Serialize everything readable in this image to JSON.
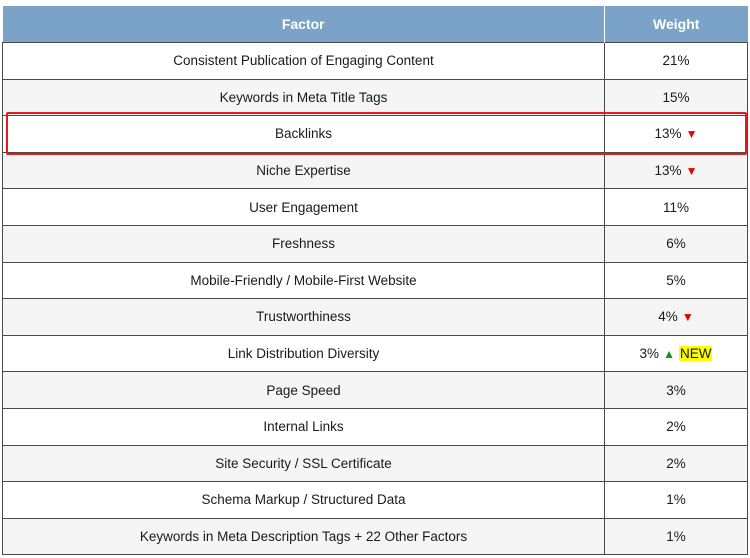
{
  "table": {
    "headers": {
      "factor": "Factor",
      "weight": "Weight"
    },
    "rows": [
      {
        "factor": "Consistent Publication of Engaging Content",
        "weight": "21%",
        "trend": "",
        "badge": ""
      },
      {
        "factor": "Keywords in Meta Title Tags",
        "weight": "15%",
        "trend": "",
        "badge": ""
      },
      {
        "factor": "Backlinks",
        "weight": "13%",
        "trend": "down",
        "badge": "",
        "highlighted": true
      },
      {
        "factor": "Niche Expertise",
        "weight": "13%",
        "trend": "down",
        "badge": ""
      },
      {
        "factor": "User Engagement",
        "weight": "11%",
        "trend": "",
        "badge": ""
      },
      {
        "factor": "Freshness",
        "weight": "6%",
        "trend": "",
        "badge": ""
      },
      {
        "factor": "Mobile-Friendly / Mobile-First Website",
        "weight": "5%",
        "trend": "",
        "badge": ""
      },
      {
        "factor": "Trustworthiness",
        "weight": "4%",
        "trend": "down",
        "badge": ""
      },
      {
        "factor": "Link Distribution Diversity",
        "weight": "3%",
        "trend": "up",
        "badge": "NEW"
      },
      {
        "factor": "Page Speed",
        "weight": "3%",
        "trend": "",
        "badge": ""
      },
      {
        "factor": "Internal Links",
        "weight": "2%",
        "trend": "",
        "badge": ""
      },
      {
        "factor": "Site Security / SSL Certificate",
        "weight": "2%",
        "trend": "",
        "badge": ""
      },
      {
        "factor": "Schema Markup / Structured Data",
        "weight": "1%",
        "trend": "",
        "badge": ""
      },
      {
        "factor": "Keywords in Meta Description Tags + 22 Other Factors",
        "weight": "1%",
        "trend": "",
        "badge": ""
      }
    ]
  },
  "icons": {
    "down": "arrow-down-icon",
    "up": "arrow-up-icon"
  },
  "colors": {
    "header_bg": "#7aa3c7",
    "arrow_down": "#e50000",
    "arrow_up": "#1e8c1e",
    "badge_bg": "#ffff00",
    "highlight_border": "#e31b1b"
  }
}
